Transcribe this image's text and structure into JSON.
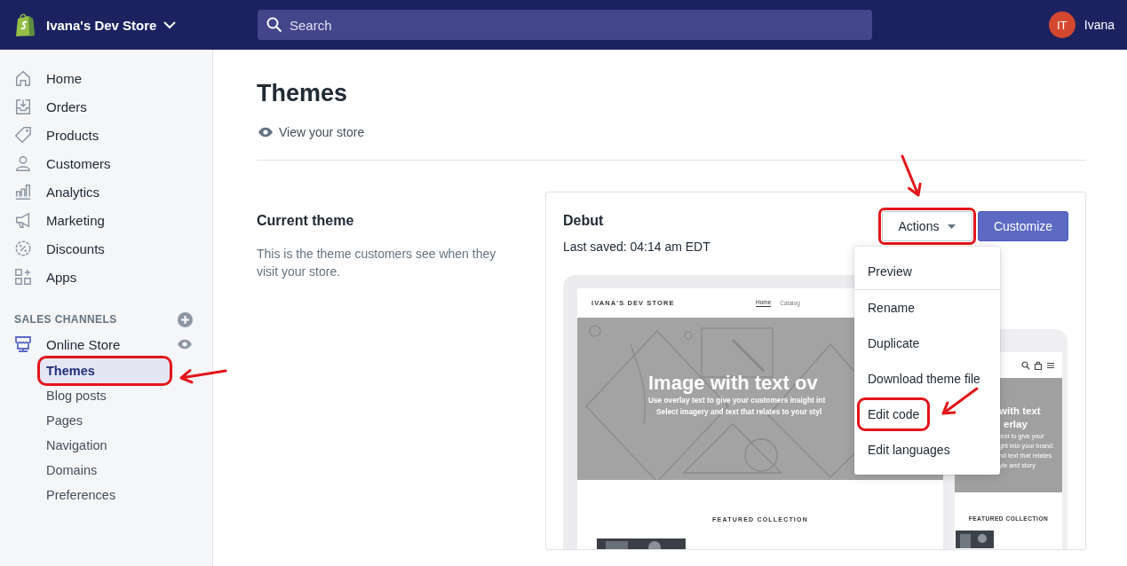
{
  "topbar": {
    "store_name": "Ivana's Dev Store",
    "search": {
      "placeholder": "Search"
    },
    "user": {
      "initials": "IT",
      "name": "Ivana"
    }
  },
  "sidebar": {
    "items": [
      {
        "label": "Home",
        "selected": false
      },
      {
        "label": "Orders",
        "selected": false
      },
      {
        "label": "Products",
        "selected": false
      },
      {
        "label": "Customers",
        "selected": false
      },
      {
        "label": "Analytics",
        "selected": false
      },
      {
        "label": "Marketing",
        "selected": false
      },
      {
        "label": "Discounts",
        "selected": false
      },
      {
        "label": "Apps",
        "selected": false
      }
    ],
    "section_title": "SALES CHANNELS",
    "channel": {
      "label": "Online Store",
      "children": [
        {
          "label": "Themes",
          "selected": true,
          "highlighted": true
        },
        {
          "label": "Blog posts",
          "selected": false,
          "highlighted": false
        },
        {
          "label": "Pages",
          "selected": false,
          "highlighted": false
        },
        {
          "label": "Navigation",
          "selected": false,
          "highlighted": false
        },
        {
          "label": "Domains",
          "selected": false,
          "highlighted": false
        },
        {
          "label": "Preferences",
          "selected": false,
          "highlighted": false
        }
      ]
    }
  },
  "page": {
    "title": "Themes",
    "view_link": "View your store"
  },
  "current_theme": {
    "heading": "Current theme",
    "description": "This is the theme customers see when they visit your store."
  },
  "theme_card": {
    "name": "Debut",
    "last_saved": "Last saved: 04:14 am EDT",
    "actions": {
      "label": "Actions",
      "highlighted": true,
      "expanded": true
    },
    "customize": "Customize",
    "menu": [
      {
        "label": "Preview",
        "highlighted": false
      },
      {
        "label": "Rename",
        "highlighted": false
      },
      {
        "label": "Duplicate",
        "highlighted": false
      },
      {
        "label": "Download theme file",
        "highlighted": false
      },
      {
        "label": "Edit code",
        "highlighted": true
      },
      {
        "label": "Edit languages",
        "highlighted": false
      }
    ],
    "preview": {
      "store_title": "IVANA'S DEV STORE",
      "nav": [
        {
          "label": "Home",
          "selected": true
        },
        {
          "label": "Catalog",
          "selected": false
        }
      ],
      "hero_title": "Image with text ov",
      "hero_lines": [
        "Use overlay text to give your customers insight int",
        "Select imagery and text that relates to your styl"
      ],
      "featured": "FEATURED COLLECTION",
      "mobile": {
        "hero_title": [
          "with text",
          "erlay"
        ],
        "hero_lines": [
          "text to give your",
          "ght into your brand.",
          "nd text that relates",
          "yle and story"
        ],
        "featured": "FEATURED COLLECTION"
      }
    }
  }
}
